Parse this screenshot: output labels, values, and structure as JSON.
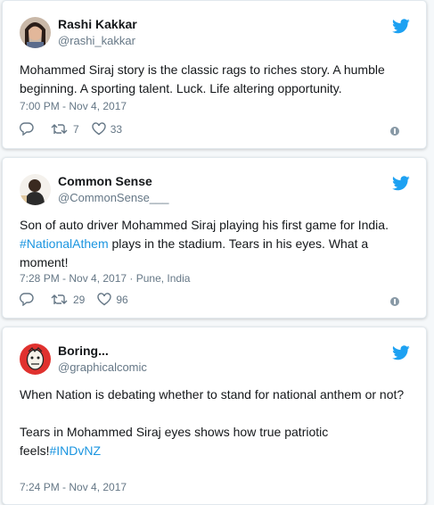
{
  "tweets": [
    {
      "name": "Rashi Kakkar",
      "handle": "@rashi_kakkar",
      "text": "Mohammed Siraj story is the classic rags to riches story. A humble beginning. A sporting talent. Luck. Life altering opportunity.",
      "meta": "7:00 PM - Nov 4, 2017",
      "retweets": "7",
      "likes": "33"
    },
    {
      "name": "Common Sense",
      "handle": "@CommonSense___",
      "text_before": "Son of auto driver Mohammed Siraj playing his first game for India.",
      "hashtag": "#NationalAthem",
      "text_after": " plays in the stadium. Tears in his eyes. What a moment!",
      "meta": "7:28 PM - Nov 4, 2017 · Pune, India",
      "retweets": "29",
      "likes": "96"
    },
    {
      "name": "Boring...",
      "handle": "@graphicalcomic",
      "text_line1": "When Nation is debating whether to stand for national anthem or not?",
      "text_line2": "Tears in Mohammed Siraj eyes shows how true patriotic feels!",
      "hashtag": "#INDvNZ",
      "meta": "7:24 PM - Nov 4, 2017"
    }
  ],
  "colors": {
    "accent": "#1da1f2",
    "link": "#1b95e0",
    "muted": "#657786"
  },
  "icons": [
    "twitter-bird-icon",
    "reply-icon",
    "retweet-icon",
    "like-icon",
    "info-icon"
  ]
}
